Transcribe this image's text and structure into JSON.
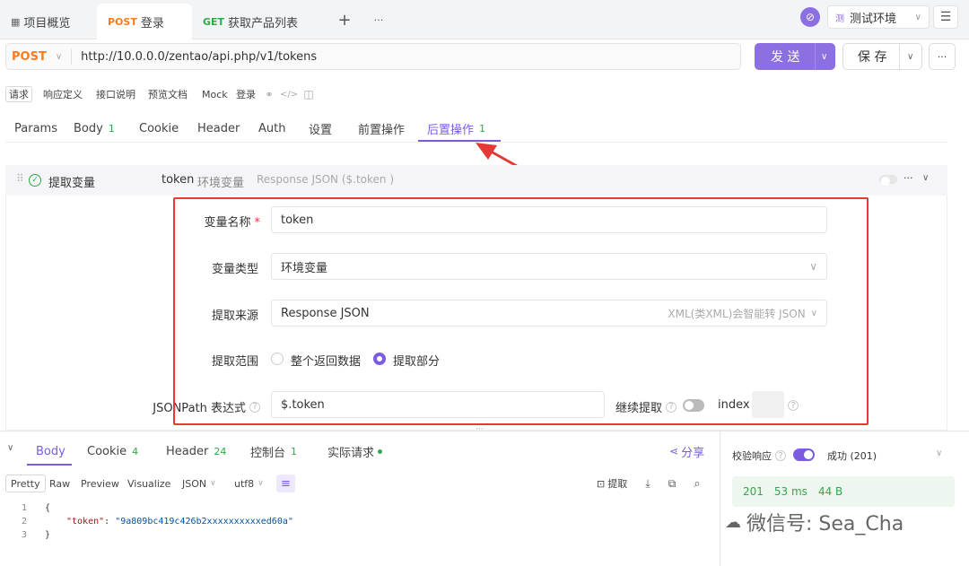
{
  "top_tabs": [
    {
      "label": "项目概览"
    },
    {
      "method": "POST",
      "label": "登录"
    },
    {
      "method": "GET",
      "label": "获取产品列表"
    }
  ],
  "add_tab": "+",
  "more_tabs": "···",
  "environment": "测试环境",
  "env_badge": "测",
  "request": {
    "method": "POST",
    "url": "http://10.0.0.0/zentao/api.php/v1/tokens",
    "send_label": "发 送",
    "save_label": "保 存"
  },
  "mini_tabs": [
    "请求",
    "响应定义",
    "接口说明",
    "预览文档",
    "Mock",
    "登录"
  ],
  "sub_tabs": [
    {
      "label": "Params"
    },
    {
      "label": "Body",
      "count": "1"
    },
    {
      "label": "Cookie"
    },
    {
      "label": "Header"
    },
    {
      "label": "Auth"
    },
    {
      "label": "设置"
    },
    {
      "label": "前置操作"
    },
    {
      "label": "后置操作",
      "count": "1"
    }
  ],
  "extract": {
    "title": "提取变量",
    "summary_name": "token",
    "summary_type": "环境变量",
    "summary_source": "Response JSON ($.token )",
    "var_name_label": "变量名称",
    "var_name_value": "token",
    "var_type_label": "变量类型",
    "var_type_value": "环境变量",
    "source_label": "提取来源",
    "source_value": "Response JSON",
    "source_hint": "XML(类XML)会智能转 JSON",
    "range_label": "提取范围",
    "range_opt1": "整个返回数据",
    "range_opt2": "提取部分",
    "jsonpath_label": "JSONPath 表达式",
    "jsonpath_value": "$.token",
    "continue_label": "继续提取",
    "index_label": "index"
  },
  "bottom_tabs": [
    {
      "label": "Body"
    },
    {
      "label": "Cookie",
      "count": "4"
    },
    {
      "label": "Header",
      "count": "24"
    },
    {
      "label": "控制台",
      "count": "1"
    },
    {
      "label": "实际请求"
    }
  ],
  "share_label": "分享",
  "format_tabs": [
    "Pretty",
    "Raw",
    "Preview",
    "Visualize",
    "JSON",
    "utf8"
  ],
  "extract_btn": "提取",
  "code_lines": [
    {
      "no": "1",
      "text": "{"
    },
    {
      "no": "2",
      "key": "\"token\"",
      "value": "\"9a809bc419c426b2xxxxxxxxxxed60a\""
    },
    {
      "no": "3",
      "text": "}"
    }
  ],
  "validate_label": "校验响应",
  "status_text": "成功 (201)",
  "stats": {
    "code": "201",
    "time": "53 ms",
    "size": "44 B"
  },
  "watermark": "微信号: Sea_Cha"
}
